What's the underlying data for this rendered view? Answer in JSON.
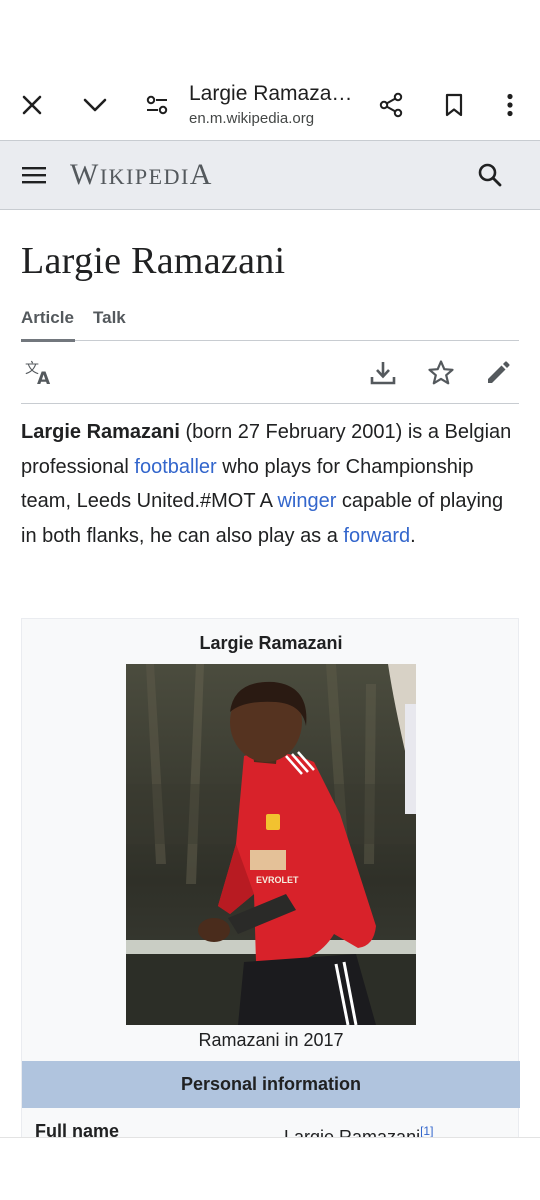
{
  "browser": {
    "page_title": "Largie Ramazani...",
    "url": "en.m.wikipedia.org",
    "icons": [
      "close-icon",
      "chevron-down-icon",
      "site-settings-icon",
      "share-icon",
      "bookmark-icon",
      "more-vert-icon"
    ]
  },
  "wiki_header": {
    "logo_text": "Wikipedia",
    "icons": [
      "menu-icon",
      "search-icon"
    ]
  },
  "article": {
    "title": "Largie Ramazani",
    "tabs": [
      {
        "label": "Article",
        "active": true
      },
      {
        "label": "Talk",
        "active": false
      }
    ],
    "action_icons": [
      "language-icon",
      "download-icon",
      "watch-star-icon",
      "edit-pencil-icon"
    ],
    "lead": {
      "bold_name": "Largie Ramazani",
      "text_1": " (born 27 February 2001) is a Belgian professional ",
      "link_1": "footballer",
      "text_2": " who plays for Championship team, Leeds United.#MOT A ",
      "link_2": "winger",
      "text_3": " capable of playing in both flanks, he can also play as a ",
      "link_3": "forward",
      "text_4": "."
    },
    "link_color": "#3366cc"
  },
  "infobox": {
    "title": "Largie Ramazani",
    "caption": "Ramazani in 2017",
    "section_header": "Personal information",
    "section_color": "#b0c4de",
    "rows": [
      {
        "label": "Full name",
        "value": "Largie Ramazani",
        "ref": "[1]"
      }
    ]
  }
}
